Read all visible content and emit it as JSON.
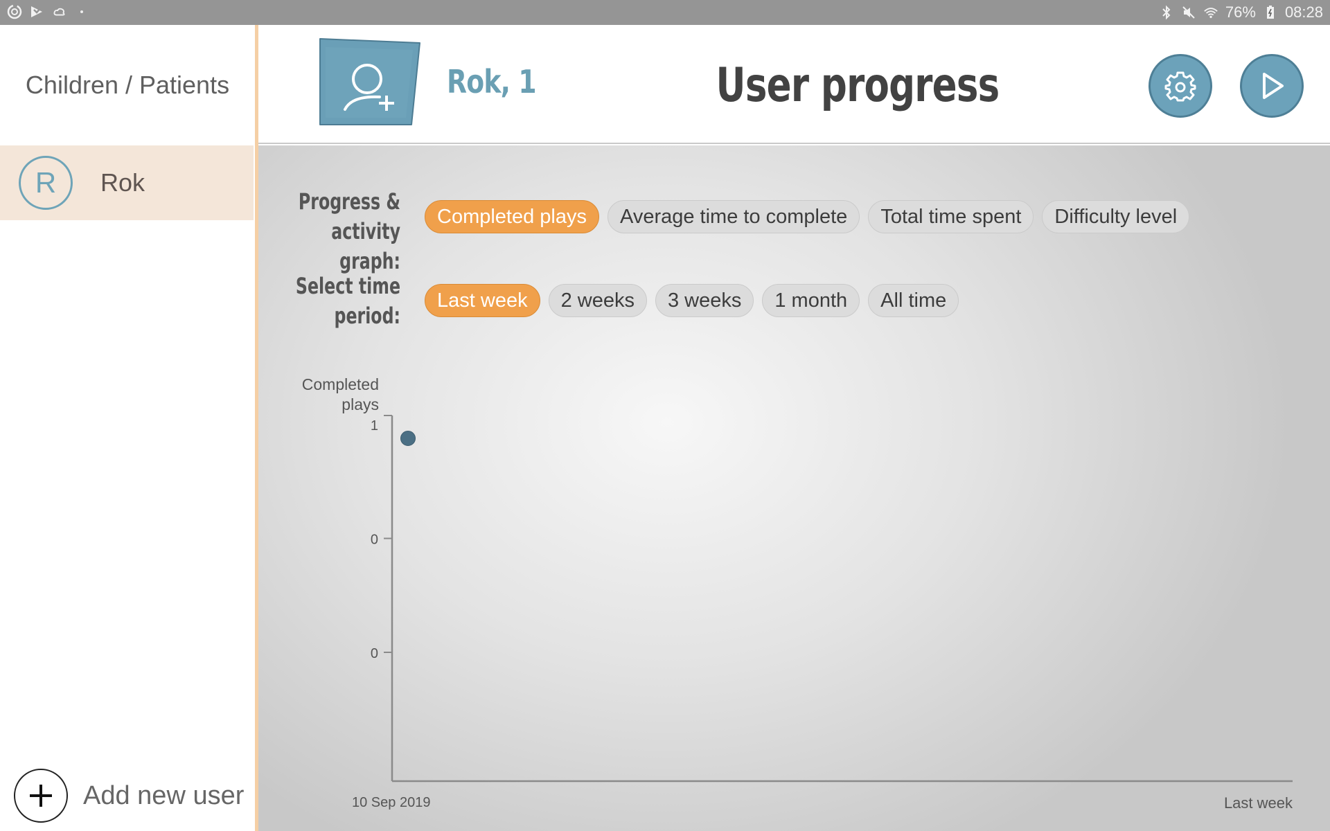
{
  "status_bar": {
    "left_icons": [
      "sync-icon",
      "flipboard-icon",
      "weather-icon",
      "dot-icon"
    ],
    "right_icons": [
      "bluetooth-icon",
      "mute-icon",
      "wifi-icon"
    ],
    "battery": "76%",
    "time": "08:28"
  },
  "sidebar": {
    "title": "Children / Patients",
    "users": [
      {
        "initial": "R",
        "name": "Rok",
        "selected": true
      }
    ],
    "add_user_label": "Add new user"
  },
  "header": {
    "user_label": "Rok, 1",
    "title": "User progress",
    "avatar_button_icon": "add-user-icon",
    "settings_icon": "gear-icon",
    "play_icon": "play-icon"
  },
  "filters": {
    "graph_label_line1": "Progress &",
    "graph_label_line2": "activity graph:",
    "graph_options": [
      {
        "label": "Completed plays",
        "active": true
      },
      {
        "label": "Average time to complete",
        "active": false
      },
      {
        "label": "Total time spent",
        "active": false
      },
      {
        "label": "Difficulty level",
        "active": false
      }
    ],
    "period_label_line1": "Select time",
    "period_label_line2": "period:",
    "period_options": [
      {
        "label": "Last week",
        "active": true
      },
      {
        "label": "2 weeks",
        "active": false
      },
      {
        "label": "3 weeks",
        "active": false
      },
      {
        "label": "1 month",
        "active": false
      },
      {
        "label": "All time",
        "active": false
      }
    ]
  },
  "colors": {
    "accent_orange": "#f0a04b",
    "brand_blue": "#6ca2ba",
    "point_color": "#4b6f84"
  },
  "chart_data": {
    "type": "scatter",
    "title": "",
    "ylabel_line1": "Completed",
    "ylabel_line2": "plays",
    "xlabel_start": "10 Sep 2019",
    "xlabel_end": "Last week",
    "y_ticks": [
      "1",
      "0",
      "0"
    ],
    "points": [
      {
        "x": "10 Sep 2019",
        "y": 1
      }
    ],
    "grid": false
  }
}
